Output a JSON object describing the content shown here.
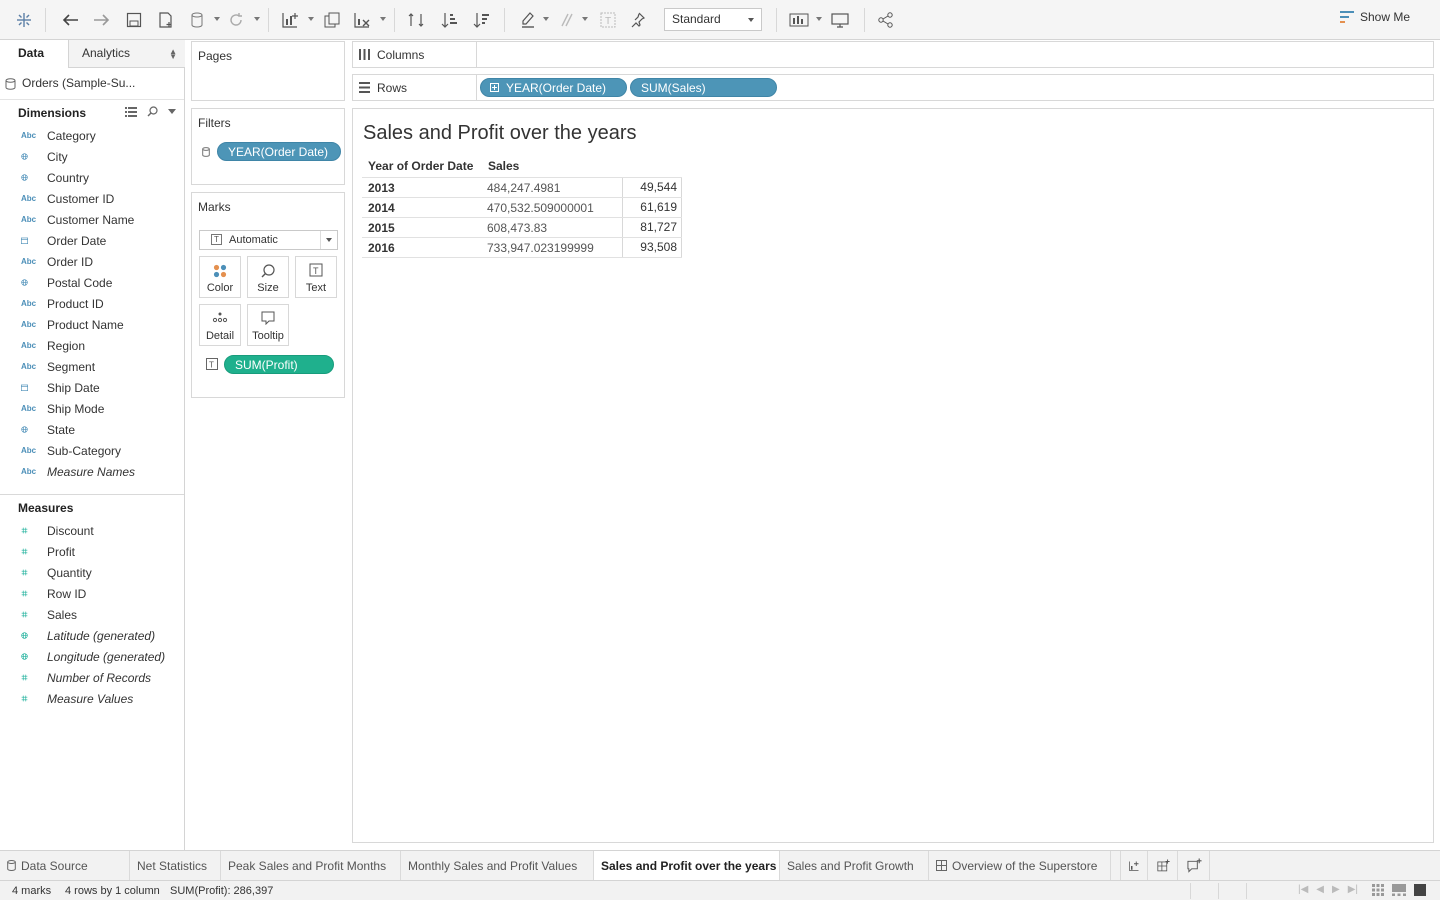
{
  "toolbar": {
    "view_size": "Standard",
    "show_me": "Show Me"
  },
  "data_pane": {
    "tabs": [
      "Data",
      "Analytics"
    ],
    "data_source": "Orders (Sample-Su...",
    "dimensions_title": "Dimensions",
    "dimensions": [
      {
        "name": "Category",
        "type": "Abc"
      },
      {
        "name": "City",
        "type": "geo"
      },
      {
        "name": "Country",
        "type": "geo"
      },
      {
        "name": "Customer ID",
        "type": "Abc"
      },
      {
        "name": "Customer Name",
        "type": "Abc"
      },
      {
        "name": "Order Date",
        "type": "date"
      },
      {
        "name": "Order ID",
        "type": "Abc"
      },
      {
        "name": "Postal Code",
        "type": "geo"
      },
      {
        "name": "Product ID",
        "type": "Abc"
      },
      {
        "name": "Product Name",
        "type": "Abc"
      },
      {
        "name": "Region",
        "type": "Abc"
      },
      {
        "name": "Segment",
        "type": "Abc"
      },
      {
        "name": "Ship Date",
        "type": "date"
      },
      {
        "name": "Ship Mode",
        "type": "Abc"
      },
      {
        "name": "State",
        "type": "geo"
      },
      {
        "name": "Sub-Category",
        "type": "Abc"
      },
      {
        "name": "Measure Names",
        "type": "Abc",
        "italic": true
      }
    ],
    "measures_title": "Measures",
    "measures": [
      {
        "name": "Discount",
        "type": "num"
      },
      {
        "name": "Profit",
        "type": "num"
      },
      {
        "name": "Quantity",
        "type": "num"
      },
      {
        "name": "Row ID",
        "type": "num"
      },
      {
        "name": "Sales",
        "type": "num"
      },
      {
        "name": "Latitude (generated)",
        "type": "geo",
        "italic": true
      },
      {
        "name": "Longitude (generated)",
        "type": "geo",
        "italic": true
      },
      {
        "name": "Number of Records",
        "type": "num",
        "italic": true
      },
      {
        "name": "Measure Values",
        "type": "num",
        "italic": true
      }
    ]
  },
  "pages": {
    "title": "Pages"
  },
  "filters": {
    "title": "Filters",
    "pill": "YEAR(Order Date)"
  },
  "marks": {
    "title": "Marks",
    "type": "Automatic",
    "buttons": [
      "Color",
      "Size",
      "Text",
      "Detail",
      "Tooltip"
    ],
    "text_pill": "SUM(Profit)"
  },
  "columns": {
    "label": "Columns"
  },
  "rows": {
    "label": "Rows",
    "pills": [
      "YEAR(Order Date)",
      "SUM(Sales)"
    ]
  },
  "view": {
    "title": "Sales and Profit over the years",
    "headers": [
      "Year of Order Date",
      "Sales"
    ],
    "rows": [
      {
        "year": "2013",
        "sales": "484,247.4981",
        "profit": "49,544"
      },
      {
        "year": "2014",
        "sales": "470,532.509000001",
        "profit": "61,619"
      },
      {
        "year": "2015",
        "sales": "608,473.83",
        "profit": "81,727"
      },
      {
        "year": "2016",
        "sales": "733,947.023199999",
        "profit": "93,508"
      }
    ]
  },
  "sheet_tabs": [
    {
      "label": "Data Source",
      "icon": "database-icon"
    },
    {
      "label": "Net Statistics"
    },
    {
      "label": "Peak Sales and Profit Months"
    },
    {
      "label": "Monthly Sales and Profit Values"
    },
    {
      "label": "Sales and Profit over the years",
      "active": true
    },
    {
      "label": "Sales and Profit Growth"
    },
    {
      "label": "Overview of the Superstore",
      "icon": "dashboard-icon"
    }
  ],
  "status": {
    "marks": "4 marks",
    "dims": "4 rows by 1 column",
    "sum": "SUM(Profit): 286,397"
  }
}
